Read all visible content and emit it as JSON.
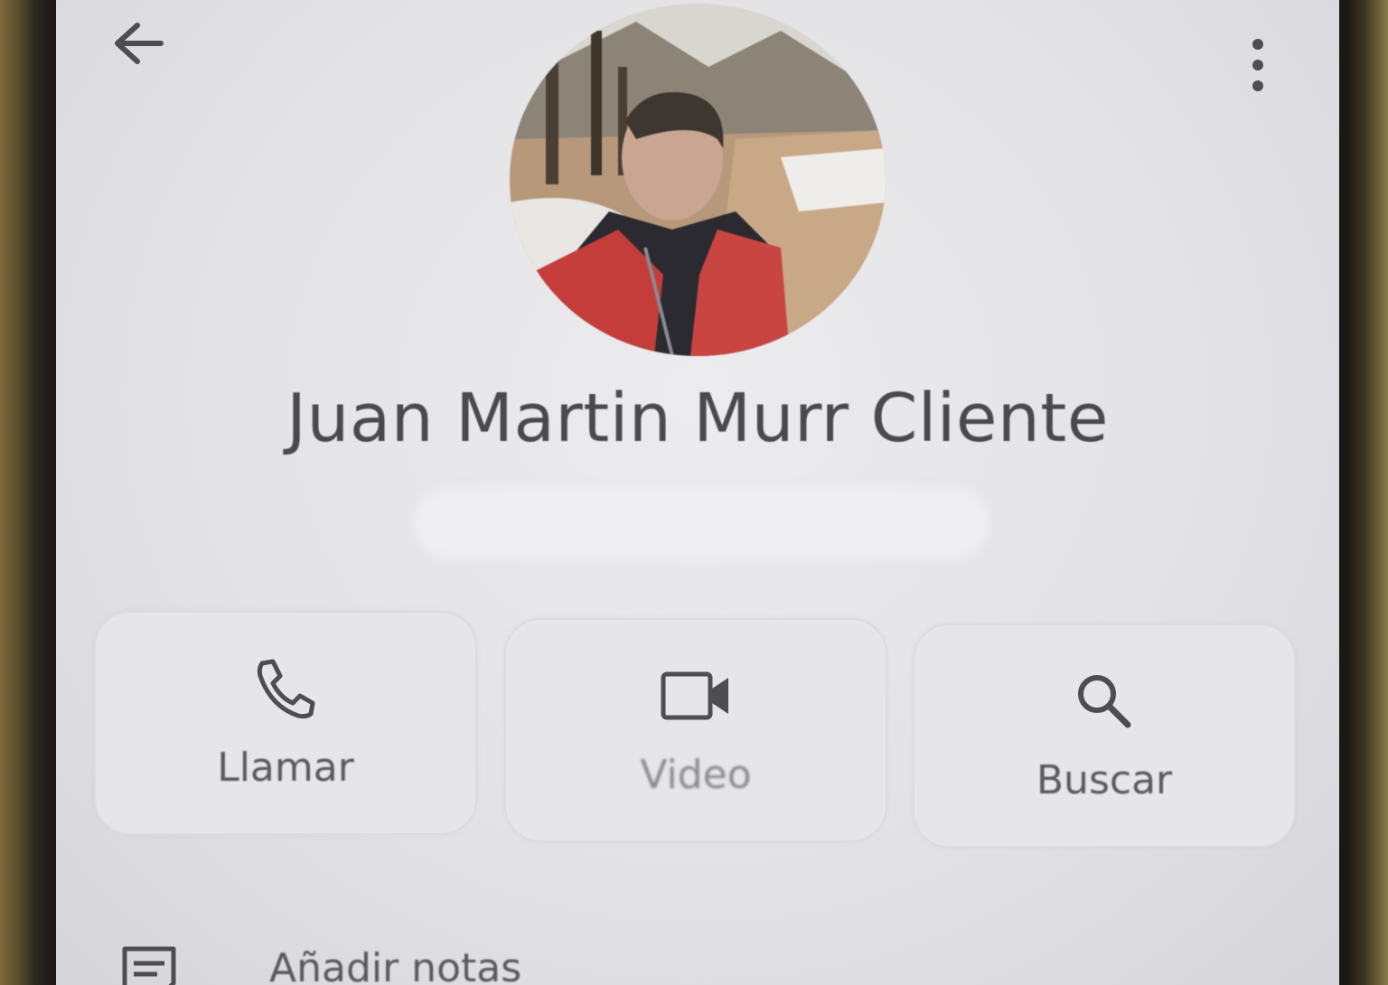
{
  "header": {
    "back_icon": "arrow-left-icon",
    "more_icon": "more-vert-icon"
  },
  "contact": {
    "name": "Juan Martin Murr Cliente",
    "avatar_icon": "contact-photo"
  },
  "actions": [
    {
      "label": "Llamar",
      "icon": "phone-icon"
    },
    {
      "label": "Video",
      "icon": "videocam-icon"
    },
    {
      "label": "Buscar",
      "icon": "search-icon"
    }
  ],
  "notes": {
    "label": "Añadir notas",
    "icon": "notes-icon"
  },
  "colors": {
    "screen_bg": "#e6e6e9",
    "text": "#4a4a4e",
    "icon": "#4e4e52"
  }
}
